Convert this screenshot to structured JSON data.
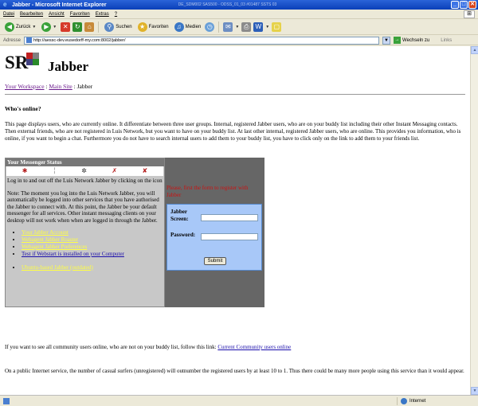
{
  "window": {
    "title": "Jabber - Microsoft Internet Explorer",
    "title_extra": "DE_SDM002 SAS500 - ODSS_01_03 #01487 SSTS 03",
    "btn_min": "_",
    "btn_max": "□",
    "btn_close": "✕"
  },
  "menu": [
    "Datei",
    "Bearbeiten",
    "Ansicht",
    "Favoriten",
    "Extras",
    "?"
  ],
  "toolbar": {
    "back": "Zurück",
    "search": "Suchen",
    "favorites": "Favoriten",
    "media": "Medien"
  },
  "address": {
    "label": "Adresse",
    "url": "http://aessc-dev.eusedorff-my.com:8002/jabber/",
    "go": "Wechseln zu",
    "links": "Links"
  },
  "page": {
    "logo_text": "SR",
    "title": "Jabber",
    "breadcrumb": {
      "workspace": "Your Workspace",
      "sep1": " : ",
      "main_site": "Main Site",
      "sep2": " : ",
      "current": "Jabber"
    },
    "section_title": "Who's online?",
    "intro": "This page displays users, who are currently online. It differentiate between three user groups. Internal, registered Jabber users, who are on your buddy list including their other Instant Messaging contacts. Then external friends, who are not registered in Luis Network, but you want to have on your buddy list. At last other internal, registered Jabber users, who are online. This provides you information, who is online, if you want to begin a chat. Furthermore you do not have to search internal users to add them to your buddy list, you have to click only on the link to add them to your friends list.",
    "messenger": {
      "heading": "Your Messenger Status",
      "para1": "Log in to and out off the Luis Network Jabber by clicking on the icon",
      "para2": "Note: The moment you log into the Luis Network Jabber, you will automatically be logged into other services that you have authorised the Jabber to connect with. At this point, the Jabber be your default messenger for all services.  Other instant messaging clients on your desktop will not work when when are logged in through the Jabber.",
      "links": [
        "Your Jabber Account",
        "Webagent Jabber Roaster",
        "Webagent Jabber Preferences",
        "Test if Webstart is installed on your Computer",
        "Ubuntu-based Jabber (outdated)"
      ]
    },
    "login": {
      "warning": "Please, first the form to register with Jabber",
      "jabber_label": "Jabber",
      "screen_label": "Screen:",
      "password_label": "Password:",
      "screen_value": "",
      "password_value": "",
      "submit": "Submit"
    },
    "bottom1_text": "If you want to see all community users online, who are not on your buddy list, follow this link: ",
    "bottom1_link": "Current Community users online",
    "bottom2": "On a public Internet service, the number of casual surfers (unregistered) will outnumber the registered users by at least 10 to 1. Thus there could be many more people using this service than it would appear."
  },
  "status": {
    "left": "",
    "zone": "Internet"
  },
  "colors": {
    "title_bar": "#0a3fb8",
    "link_visited": "#6a1a8c",
    "link_yellow": "#ffff44",
    "login_bg": "#a8c8f8",
    "warning": "#cc1111"
  }
}
